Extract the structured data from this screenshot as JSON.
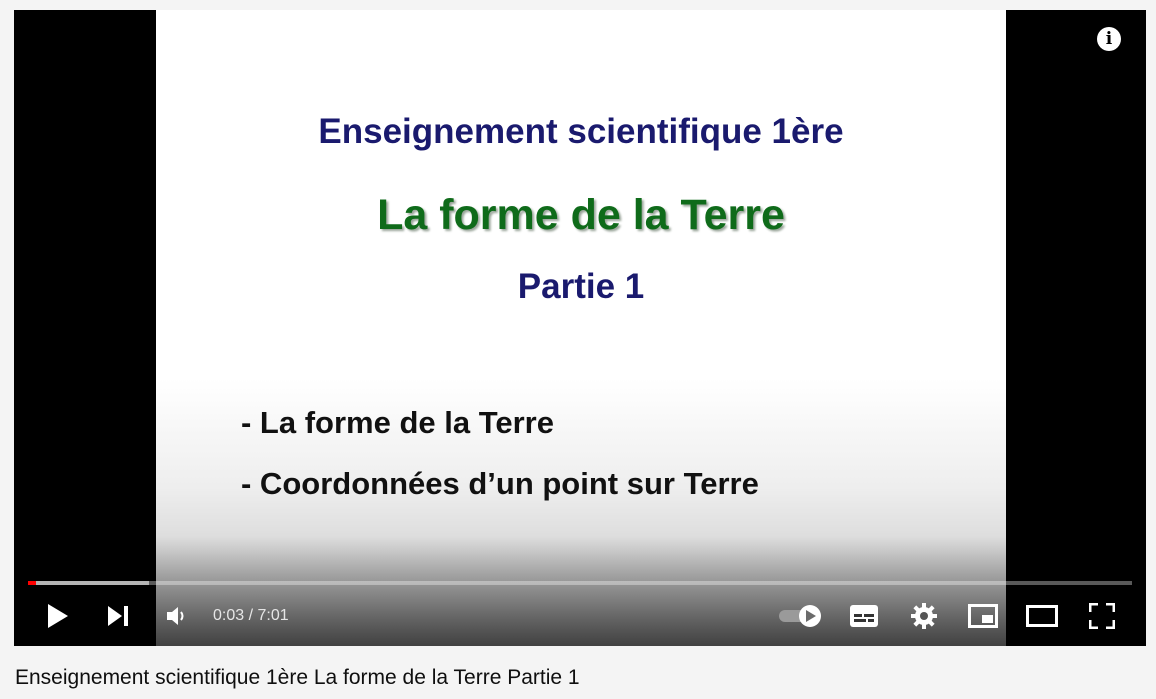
{
  "slide": {
    "subject": "Enseignement scientifique 1ère",
    "title": "La forme de la Terre",
    "part": "Partie 1",
    "bullets": [
      "- La forme de la Terre",
      "- Coordonnées d’un point sur Terre"
    ]
  },
  "player": {
    "info_glyph": "i",
    "current_time": "0:03",
    "separator": " / ",
    "duration": "7:01",
    "progress_played_fraction": 0.007,
    "progress_buffered_fraction": 0.11,
    "icons": [
      "play-icon",
      "next-icon",
      "volume-icon",
      "autoplay-toggle-icon",
      "subtitles-icon",
      "settings-icon",
      "miniplayer-icon",
      "theater-mode-icon",
      "fullscreen-icon"
    ],
    "accent_color": "#ff0000"
  },
  "video_title": "Enseignement scientifique 1ère La forme de la Terre Partie 1"
}
